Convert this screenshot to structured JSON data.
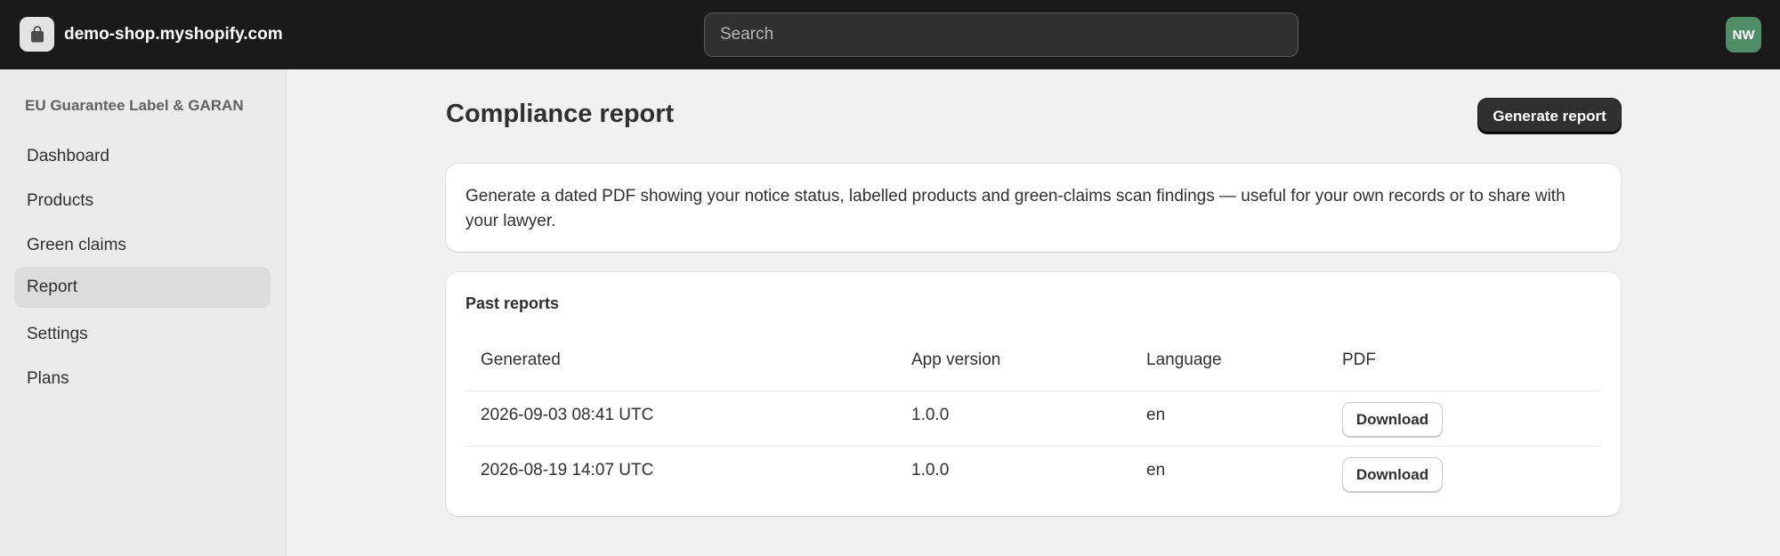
{
  "topbar": {
    "store_name": "demo-shop.myshopify.com",
    "store_icon": "shopping-bag-icon",
    "search_placeholder": "Search",
    "avatar_initials": "NW",
    "avatar_color": "#4f8d67"
  },
  "sidebar": {
    "app_name": "EU Guarantee Label & GARAN",
    "items": [
      {
        "label": "Dashboard",
        "active": false
      },
      {
        "label": "Products",
        "active": false
      },
      {
        "label": "Green claims",
        "active": false
      },
      {
        "label": "Report",
        "active": true
      },
      {
        "label": "Settings",
        "active": false
      },
      {
        "label": "Plans",
        "active": false
      }
    ]
  },
  "page": {
    "title": "Compliance report",
    "primary_action": "Generate report",
    "description": "Generate a dated PDF showing your notice status, labelled products and green-claims scan findings — useful for your own records or to share with your lawyer."
  },
  "past_reports": {
    "heading": "Past reports",
    "columns": [
      "Generated",
      "App version",
      "Language",
      "PDF"
    ],
    "rows": [
      {
        "generated": "2026-09-03 08:41 UTC",
        "app_version": "1.0.0",
        "language": "en",
        "pdf_action": "Download"
      },
      {
        "generated": "2026-08-19 14:07 UTC",
        "app_version": "1.0.0",
        "language": "en",
        "pdf_action": "Download"
      }
    ]
  }
}
